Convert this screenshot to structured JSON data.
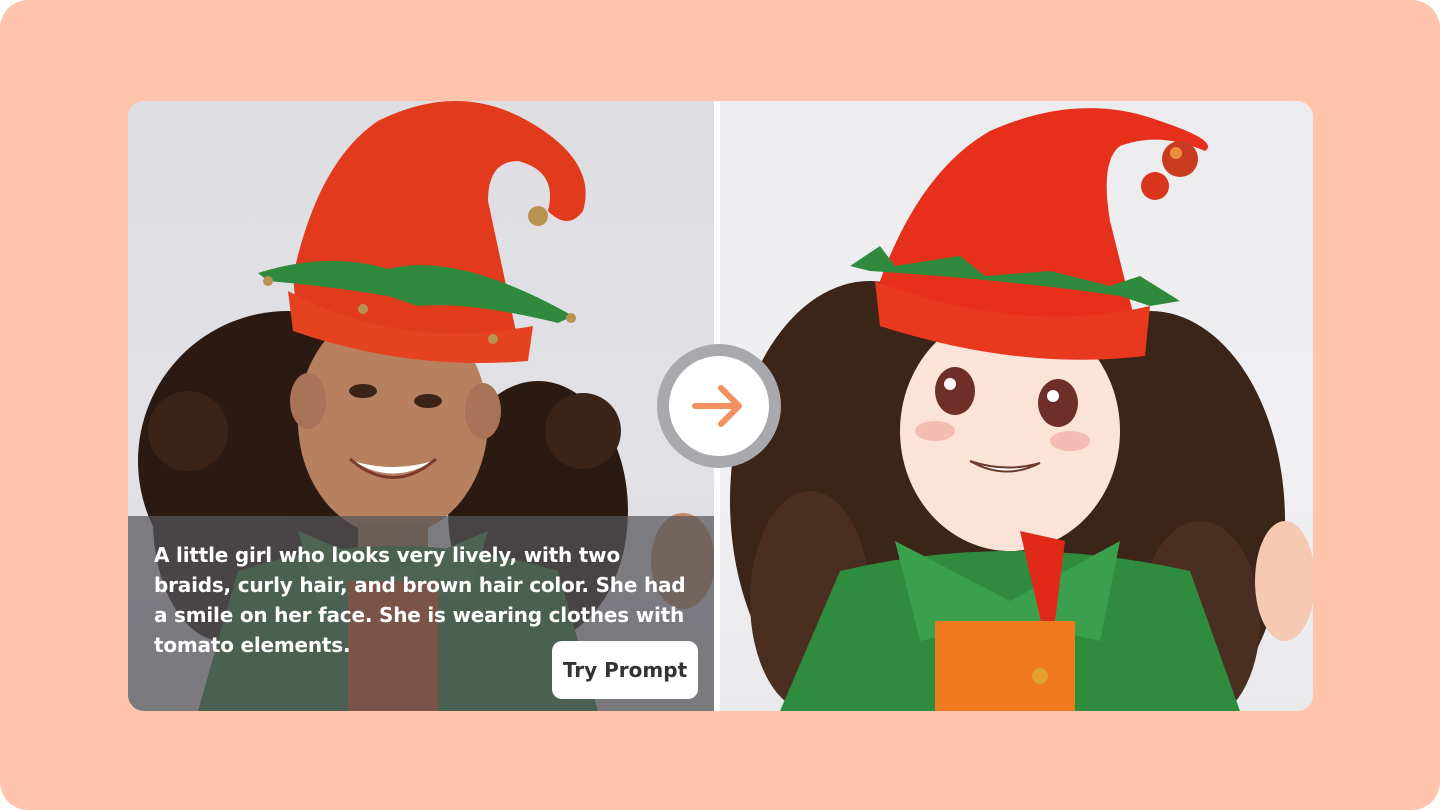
{
  "prompt": {
    "text": "A little girl who looks very lively, with two braids, curly hair, and brown hair color. She had a smile on her face. She is wearing clothes with tomato elements.",
    "button_label": "Try Prompt"
  },
  "images": {
    "left_icon": "photo-original",
    "right_icon": "anime-result"
  },
  "colors": {
    "page_bg": "#ffc4ab",
    "arrow_accent": "#f29060",
    "overlay": "rgba(85,85,90,0.72)",
    "button_bg": "#ffffff"
  },
  "icons": {
    "arrow": "arrow-right-icon"
  }
}
